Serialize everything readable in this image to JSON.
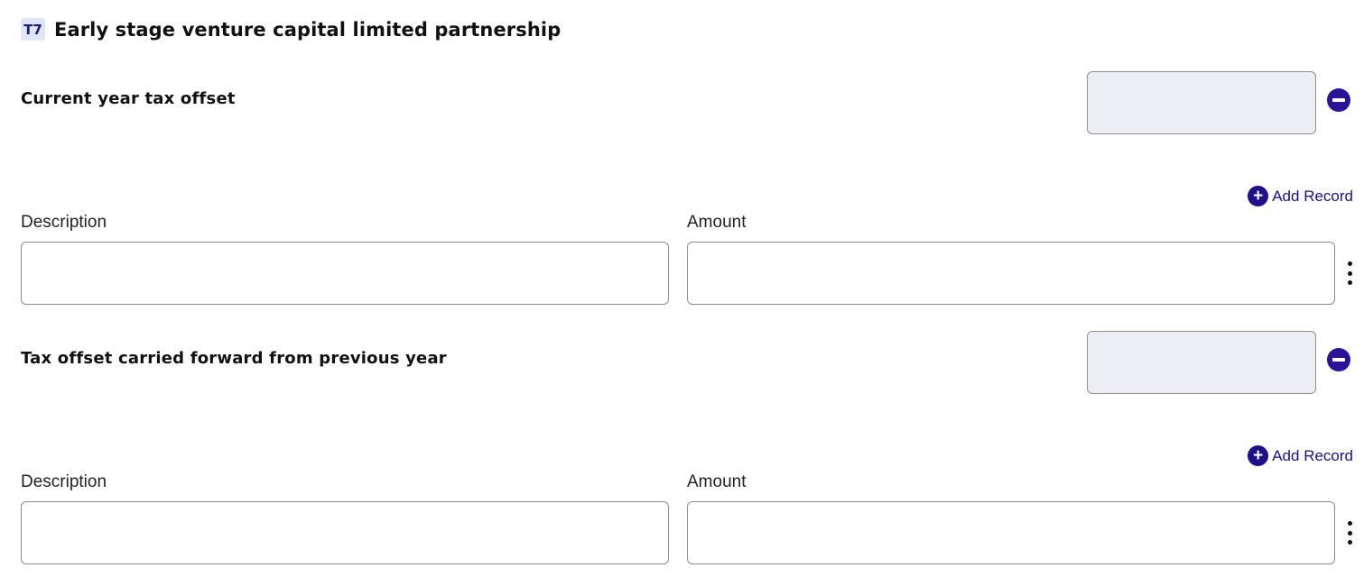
{
  "section": {
    "code": "T7",
    "title": "Early stage venture capital limited partnership"
  },
  "groups": [
    {
      "label": "Current year tax offset",
      "add_record_label": "Add Record",
      "columns": {
        "description": "Description",
        "amount": "Amount"
      },
      "records": [
        {
          "description": "",
          "amount": ""
        }
      ]
    },
    {
      "label": "Tax offset carried forward from previous year",
      "add_record_label": "Add Record",
      "columns": {
        "description": "Description",
        "amount": "Amount"
      },
      "records": [
        {
          "description": "",
          "amount": ""
        }
      ]
    }
  ],
  "icons": {
    "remove": "minus-circle-icon",
    "add": "plus-circle-icon",
    "more": "vertical-ellipsis-icon"
  },
  "colors": {
    "accent": "#1e0f8c",
    "badge_bg": "#dfe6f7",
    "readonly_field_bg": "#eceef3"
  }
}
